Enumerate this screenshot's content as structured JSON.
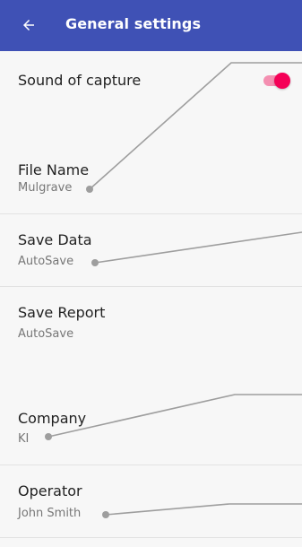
{
  "app_bar": {
    "title": "General settings",
    "back_icon": "arrow-left-icon",
    "background": "#3f51b5"
  },
  "settings": {
    "sound_of_capture": {
      "title": "Sound of capture",
      "enabled": true,
      "accent": "#f50057"
    },
    "file_name": {
      "title": "File Name",
      "value": "Mulgrave"
    },
    "save_data": {
      "title": "Save Data",
      "value": "AutoSave"
    },
    "save_report": {
      "title": "Save Report",
      "value": "AutoSave"
    },
    "company": {
      "title": "Company",
      "value": "KI"
    },
    "operator": {
      "title": "Operator",
      "value": "John Smith"
    }
  },
  "callout_color": "#9e9e9e"
}
